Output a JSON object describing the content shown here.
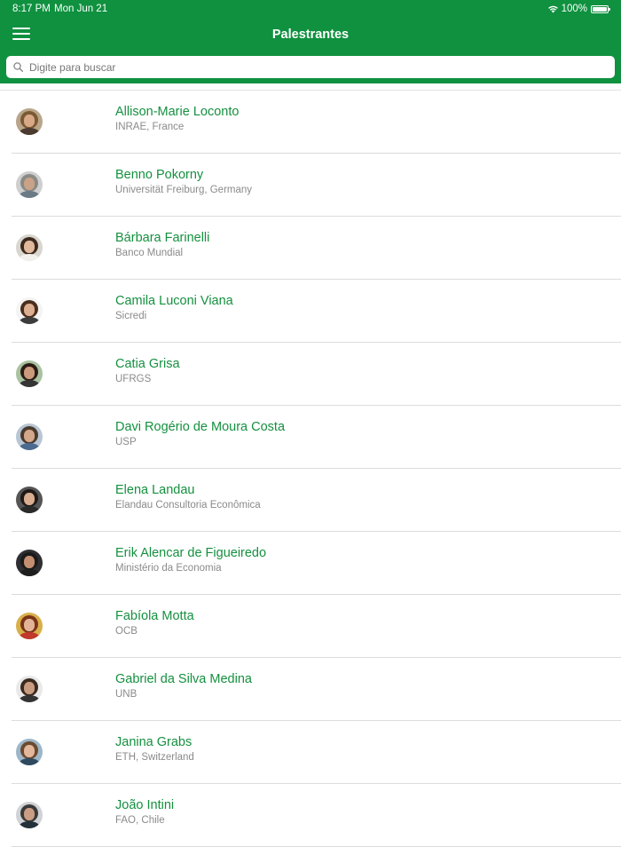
{
  "status": {
    "time": "8:17 PM",
    "date": "Mon Jun 21",
    "battery": "100%"
  },
  "header": {
    "title": "Palestrantes",
    "menu_icon": "hamburger-icon"
  },
  "search": {
    "placeholder": "Digite para buscar",
    "value": ""
  },
  "speakers": [
    {
      "name": "Allison-Marie Loconto",
      "org": "INRAE, France",
      "avatar": {
        "bg": "#b9a589",
        "hair": "#7a5a34",
        "skin": "#d9a987",
        "body": "#4a3a30"
      }
    },
    {
      "name": "Benno Pokorny",
      "org": "Universität Freiburg, Germany",
      "avatar": {
        "bg": "#cfcfcf",
        "hair": "#8a8a86",
        "skin": "#c9a287",
        "body": "#6b7b86"
      }
    },
    {
      "name": "Bárbara Farinelli",
      "org": "Banco Mundial",
      "avatar": {
        "bg": "#d9d6d0",
        "hair": "#3d2a1e",
        "skin": "#e0b89c",
        "body": "#f2f0ec"
      }
    },
    {
      "name": "Camila Luconi Viana",
      "org": "Sicredi",
      "avatar": {
        "bg": "#f4f4f4",
        "hair": "#4a2e1c",
        "skin": "#dcae92",
        "body": "#3c3c3c"
      }
    },
    {
      "name": "Catia Grisa",
      "org": "UFRGS",
      "avatar": {
        "bg": "#a9c2a0",
        "hair": "#2b1d16",
        "skin": "#c99a7c",
        "body": "#353535"
      }
    },
    {
      "name": "Davi Rogério de Moura Costa",
      "org": "USP",
      "avatar": {
        "bg": "#b8c6d4",
        "hair": "#4a3a2e",
        "skin": "#d3a78a",
        "body": "#4b6a8f"
      }
    },
    {
      "name": "Elena Landau",
      "org": "Elandau Consultoria Econômica",
      "avatar": {
        "bg": "#555555",
        "hair": "#1f1a17",
        "skin": "#d8ad90",
        "body": "#2a2a2a"
      }
    },
    {
      "name": "Erik Alencar de Figueiredo",
      "org": "Ministério da Economia",
      "avatar": {
        "bg": "#2f2f33",
        "hair": "#1b1b1b",
        "skin": "#c48f70",
        "body": "#1e1e1e"
      }
    },
    {
      "name": "Fabíola Motta",
      "org": "OCB",
      "avatar": {
        "bg": "#d8b04a",
        "hair": "#7a3418",
        "skin": "#e3b397",
        "body": "#c0392b"
      }
    },
    {
      "name": "Gabriel da Silva Medina",
      "org": "UNB",
      "avatar": {
        "bg": "#e9e9e9",
        "hair": "#3a2a20",
        "skin": "#c89c80",
        "body": "#333333"
      }
    },
    {
      "name": "Janina Grabs",
      "org": "ETH, Switzerland",
      "avatar": {
        "bg": "#9db6c9",
        "hair": "#6b4a2e",
        "skin": "#e2b79c",
        "body": "#2f4a5e"
      }
    },
    {
      "name": "João Intini",
      "org": "FAO, Chile",
      "avatar": {
        "bg": "#cfd3d6",
        "hair": "#3a3a3a",
        "skin": "#c99e84",
        "body": "#23303a"
      }
    }
  ]
}
